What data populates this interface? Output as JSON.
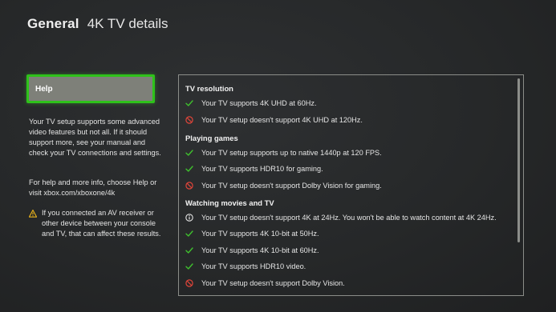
{
  "header": {
    "section": "General",
    "title": "4K TV details"
  },
  "help": {
    "label": "Help",
    "intro": "Your TV setup supports some advanced video features but not all. If it should support more, see your manual and check your TV connections and settings.",
    "more_info": "For help and more info, choose Help or visit xbox.com/xboxone/4k",
    "warning": "If you connected an AV receiver or other device between your console and TV, that can affect these results."
  },
  "details": {
    "tv_resolution": {
      "heading": "TV resolution",
      "items": [
        {
          "icon": "check-icon",
          "text": "Your TV supports 4K UHD at 60Hz."
        },
        {
          "icon": "not-supported-icon",
          "text": "Your TV setup doesn't support 4K UHD at 120Hz."
        }
      ]
    },
    "playing_games": {
      "heading": "Playing games",
      "items": [
        {
          "icon": "check-icon",
          "text": "Your TV setup supports up to native 1440p at 120 FPS."
        },
        {
          "icon": "check-icon",
          "text": "Your TV supports HDR10 for gaming."
        },
        {
          "icon": "not-supported-icon",
          "text": "Your TV setup doesn't support Dolby Vision for gaming."
        }
      ]
    },
    "watching_movies": {
      "heading": "Watching movies and TV",
      "items": [
        {
          "icon": "info-icon",
          "text": "Your TV setup doesn't support 4K at 24Hz. You won't be able to watch content at 4K 24Hz."
        },
        {
          "icon": "check-icon",
          "text": "Your TV supports 4K 10-bit at 50Hz."
        },
        {
          "icon": "check-icon",
          "text": "Your TV supports 4K 10-bit at 60Hz."
        },
        {
          "icon": "check-icon",
          "text": "Your TV supports HDR10 video."
        },
        {
          "icon": "not-supported-icon",
          "text": "Your TV setup doesn't support Dolby Vision."
        }
      ]
    }
  },
  "colors": {
    "accent_green": "#2ec21a",
    "check_green": "#3fbf2e",
    "not_supported_red": "#e0453a",
    "warning_yellow": "#e8b21c"
  }
}
